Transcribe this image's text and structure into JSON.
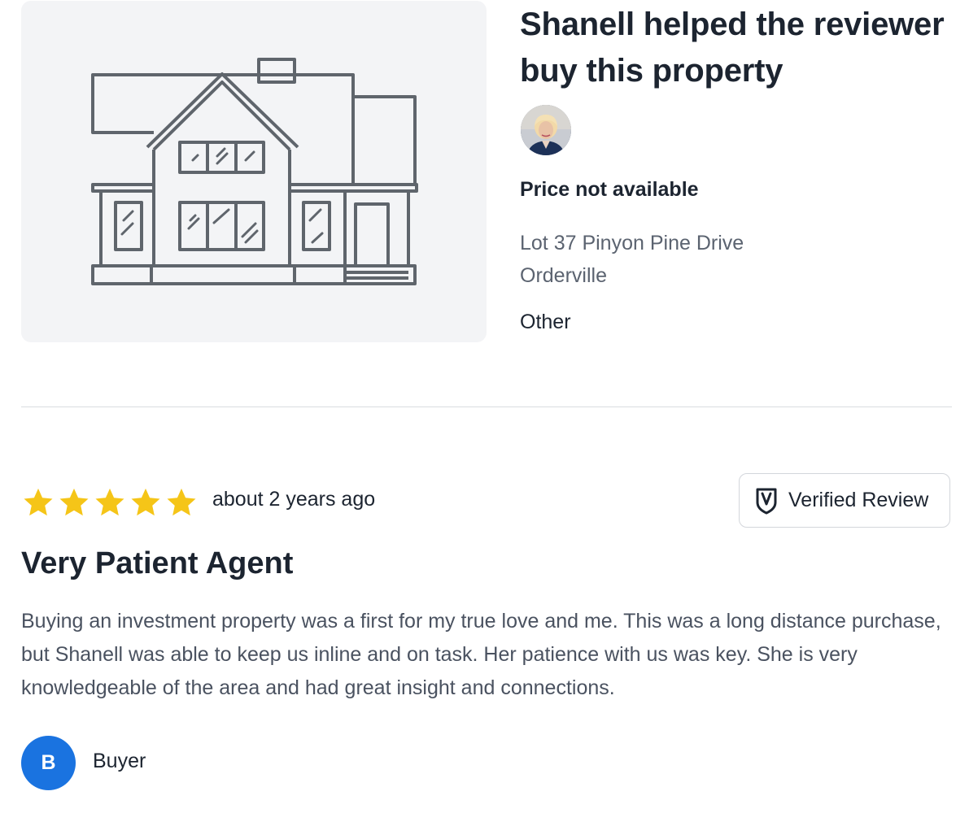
{
  "listing": {
    "heading": "Shanell helped the reviewer buy this property",
    "price": "Price not available",
    "address_line1": "Lot 37 Pinyon Pine Drive",
    "address_line2": "Orderville",
    "property_type": "Other",
    "image_icon": "house-outline-icon",
    "agent_avatar_icon": "agent-photo"
  },
  "review": {
    "rating": 5,
    "max_rating": 5,
    "timestamp": "about 2 years ago",
    "verified_label": "Verified Review",
    "verified_icon": "shield-check-icon",
    "title": "Very Patient Agent",
    "body": "Buying an investment property was a first for my true love and me. This was a long distance purchase, but Shanell was able to keep us inline and on task. Her patience with us was key. She is very knowledgeable of the area and had great insight and connections.",
    "reviewer_initial": "B",
    "reviewer_role": "Buyer"
  },
  "colors": {
    "star": "#F5C518",
    "avatar_blue": "#1A73E0",
    "image_bg": "#F3F4F6",
    "house_stroke": "#5F656C"
  }
}
